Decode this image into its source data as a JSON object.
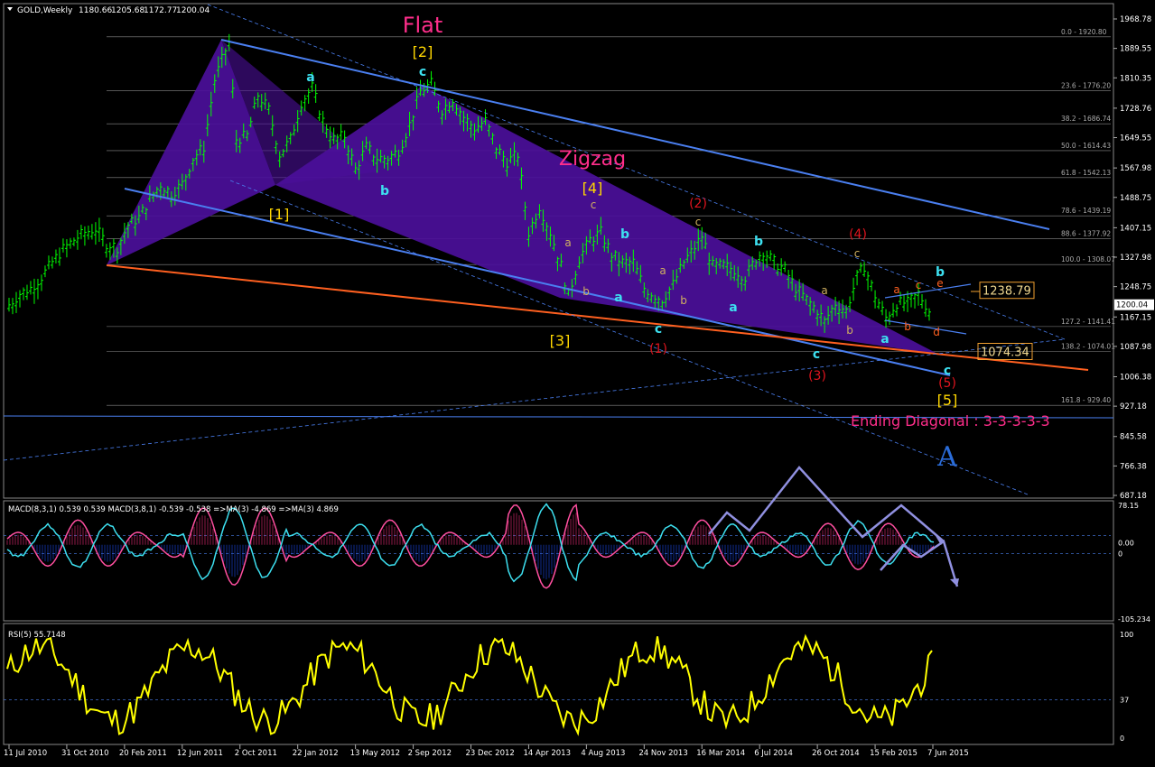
{
  "chart_data": [
    {
      "type": "line",
      "panel": "price",
      "title": "GOLD,Weekly",
      "ohlc_header": [
        "1180.66",
        "1205.68",
        "1172.77",
        "1200.04"
      ],
      "current_price": "1200.04",
      "y_ticks": [
        "1968.78",
        "1889.55",
        "1810.35",
        "1728.76",
        "1649.55",
        "1567.98",
        "1488.75",
        "1407.15",
        "1327.98",
        "1248.75",
        "1167.15",
        "1087.98",
        "1006.38",
        "927.18",
        "845.58",
        "766.38",
        "687.18"
      ],
      "x_ticks": [
        "11 Jul 2010",
        "31 Oct 2010",
        "20 Feb 2011",
        "12 Jun 2011",
        "2 Oct 2011",
        "22 Jan 2012",
        "13 May 2012",
        "2 Sep 2012",
        "23 Dec 2012",
        "14 Apr 2013",
        "4 Aug 2013",
        "24 Nov 2013",
        "16 Mar 2014",
        "6 Jul 2014",
        "26 Oct 2014",
        "15 Feb 2015",
        "7 Jun 2015"
      ],
      "ylim": [
        680,
        1975
      ],
      "fib_levels": [
        {
          "label": "0.0 - 1920.80",
          "value": 1920.8
        },
        {
          "label": "23.6 - 1776.20",
          "value": 1776.2
        },
        {
          "label": "38.2 - 1686.74",
          "value": 1686.74
        },
        {
          "label": "50.0 - 1614.43",
          "value": 1614.43
        },
        {
          "label": "61.8 - 1542.13",
          "value": 1542.13
        },
        {
          "label": "78.6 - 1439.19",
          "value": 1439.19
        },
        {
          "label": "88.6 - 1377.92",
          "value": 1377.92
        },
        {
          "label": "100.0 - 1308.07",
          "value": 1308.07
        },
        {
          "label": "127.2 - 1141.41",
          "value": 1141.41
        },
        {
          "label": "138.2 - 1074.01",
          "value": 1074.01
        },
        {
          "label": "161.8 - 929.40",
          "value": 929.4
        }
      ],
      "price_series": [
        [
          "11 Jul 2010",
          1195
        ],
        [
          "1 Aug 2010",
          1225
        ],
        [
          "22 Aug 2010",
          1240
        ],
        [
          "12 Sep 2010",
          1270
        ],
        [
          "3 Oct 2010",
          1310
        ],
        [
          "24 Oct 2010",
          1345
        ],
        [
          "14 Nov 2010",
          1370
        ],
        [
          "5 Dec 2010",
          1390
        ],
        [
          "26 Dec 2010",
          1400
        ],
        [
          "16 Jan 2011",
          1360
        ],
        [
          "6 Feb 2011",
          1350
        ],
        [
          "27 Feb 2011",
          1410
        ],
        [
          "20 Mar 2011",
          1430
        ],
        [
          "10 Apr 2011",
          1480
        ],
        [
          "1 May 2011",
          1520
        ],
        [
          "22 May 2011",
          1495
        ],
        [
          "12 Jun 2011",
          1520
        ],
        [
          "3 Jul 2011",
          1590
        ],
        [
          "24 Jul 2011",
          1620
        ],
        [
          "14 Aug 2011",
          1800
        ],
        [
          "4 Sep 2011",
          1880
        ],
        [
          "11 Sep 2011",
          1900
        ],
        [
          "25 Sep 2011",
          1640
        ],
        [
          "16 Oct 2011",
          1650
        ],
        [
          "6 Nov 2011",
          1760
        ],
        [
          "27 Nov 2011",
          1720
        ],
        [
          "18 Dec 2011",
          1600
        ],
        [
          "8 Jan 2012",
          1640
        ],
        [
          "29 Jan 2012",
          1740
        ],
        [
          "19 Feb 2012",
          1780
        ],
        [
          "11 Mar 2012",
          1690
        ],
        [
          "1 Apr 2012",
          1640
        ],
        [
          "22 Apr 2012",
          1650
        ],
        [
          "13 May 2012",
          1560
        ],
        [
          "3 Jun 2012",
          1620
        ],
        [
          "24 Jun 2012",
          1590
        ],
        [
          "15 Jul 2012",
          1590
        ],
        [
          "5 Aug 2012",
          1610
        ],
        [
          "26 Aug 2012",
          1680
        ],
        [
          "16 Sep 2012",
          1770
        ],
        [
          "7 Oct 2012",
          1790
        ],
        [
          "28 Oct 2012",
          1720
        ],
        [
          "18 Nov 2012",
          1750
        ],
        [
          "9 Dec 2012",
          1700
        ],
        [
          "30 Dec 2012",
          1670
        ],
        [
          "20 Jan 2013",
          1690
        ],
        [
          "10 Feb 2013",
          1620
        ],
        [
          "3 Mar 2013",
          1580
        ],
        [
          "24 Mar 2013",
          1600
        ],
        [
          "14 Apr 2013",
          1390
        ],
        [
          "5 May 2013",
          1460
        ],
        [
          "26 May 2013",
          1390
        ],
        [
          "16 Jun 2013",
          1300
        ],
        [
          "30 Jun 2013",
          1220
        ],
        [
          "21 Jul 2013",
          1320
        ],
        [
          "11 Aug 2013",
          1370
        ],
        [
          "1 Sep 2013",
          1390
        ],
        [
          "22 Sep 2013",
          1330
        ],
        [
          "13 Oct 2013",
          1310
        ],
        [
          "3 Nov 2013",
          1310
        ],
        [
          "24 Nov 2013",
          1240
        ],
        [
          "15 Dec 2013",
          1220
        ],
        [
          "29 Dec 2013",
          1210
        ],
        [
          "19 Jan 2014",
          1250
        ],
        [
          "9 Feb 2014",
          1310
        ],
        [
          "2 Mar 2014",
          1350
        ],
        [
          "16 Mar 2014",
          1380
        ],
        [
          "6 Apr 2014",
          1300
        ],
        [
          "27 Apr 2014",
          1300
        ],
        [
          "18 May 2014",
          1290
        ],
        [
          "8 Jun 2014",
          1270
        ],
        [
          "29 Jun 2014",
          1320
        ],
        [
          "13 Jul 2014",
          1340
        ],
        [
          "3 Aug 2014",
          1310
        ],
        [
          "24 Aug 2014",
          1290
        ],
        [
          "14 Sep 2014",
          1240
        ],
        [
          "5 Oct 2014",
          1210
        ],
        [
          "26 Oct 2014",
          1180
        ],
        [
          "9 Nov 2014",
          1150
        ],
        [
          "30 Nov 2014",
          1200
        ],
        [
          "21 Dec 2014",
          1180
        ],
        [
          "11 Jan 2015",
          1270
        ],
        [
          "25 Jan 2015",
          1300
        ],
        [
          "15 Feb 2015",
          1220
        ],
        [
          "8 Mar 2015",
          1160
        ],
        [
          "29 Mar 2015",
          1200
        ],
        [
          "19 Apr 2015",
          1200
        ],
        [
          "10 May 2015",
          1225
        ],
        [
          "31 May 2015",
          1180
        ],
        [
          "7 Jun 2015",
          1200
        ]
      ],
      "wave_labels": [
        {
          "text": "Flat",
          "color": "#ff2e8b"
        },
        {
          "text": "Zigzag",
          "color": "#ff2e8b"
        },
        {
          "text": "[1]",
          "color": "#ffd700"
        },
        {
          "text": "[2]",
          "color": "#ffd700"
        },
        {
          "text": "[3]",
          "color": "#ffd700"
        },
        {
          "text": "[4]",
          "color": "#ffd700"
        },
        {
          "text": "[5]",
          "color": "#ffd700"
        },
        {
          "text": "a",
          "color": "#3de0f0"
        },
        {
          "text": "b",
          "color": "#3de0f0"
        },
        {
          "text": "c",
          "color": "#3de0f0"
        },
        {
          "text": "(1)",
          "color": "#e0141e"
        },
        {
          "text": "(2)",
          "color": "#e0141e"
        },
        {
          "text": "(3)",
          "color": "#e0141e"
        },
        {
          "text": "(4)",
          "color": "#e0141e"
        },
        {
          "text": "(5)",
          "color": "#e0141e"
        },
        {
          "text": "Ending Diagonal : 3-3-3-3-3",
          "color": "#ff2e8b"
        },
        {
          "text": "A",
          "color": "#2a6cd9"
        }
      ],
      "price_boxes": [
        {
          "text": "1238.79",
          "value": 1238.79
        },
        {
          "text": "1074.34",
          "value": 1074.34
        }
      ]
    },
    {
      "type": "line",
      "panel": "macd",
      "title": "MACD(8,3,1) 0.539 0.539  MACD(3,8,1) -0.539 -0.538  =>MA(3) -4.869  =>MA(3) 4.869",
      "y_ticks": [
        "78.15",
        "0.00",
        "0",
        "-105.234"
      ],
      "ylim": [
        -105.234,
        78.15
      ],
      "series": [
        {
          "name": "MACD(8,3,1)",
          "color": "#ff4fa0"
        },
        {
          "name": "MACD(3,8,1)",
          "color": "#3de0f0"
        }
      ]
    },
    {
      "type": "line",
      "panel": "rsi",
      "title": "RSI(5) 55.7148",
      "y_ticks": [
        "100",
        "37",
        "0"
      ],
      "ylim": [
        0,
        100
      ],
      "series": [
        {
          "name": "RSI(5)",
          "color": "#ffff00"
        }
      ]
    }
  ],
  "colors": {
    "background": "#000000",
    "up_bar": "#00ff00",
    "channel": "#4a7ff0",
    "triangle_fill": "#4b0f9a",
    "trendline": "#ff6020",
    "fib": "#8a8a8a",
    "price_box": "#f0a030"
  }
}
